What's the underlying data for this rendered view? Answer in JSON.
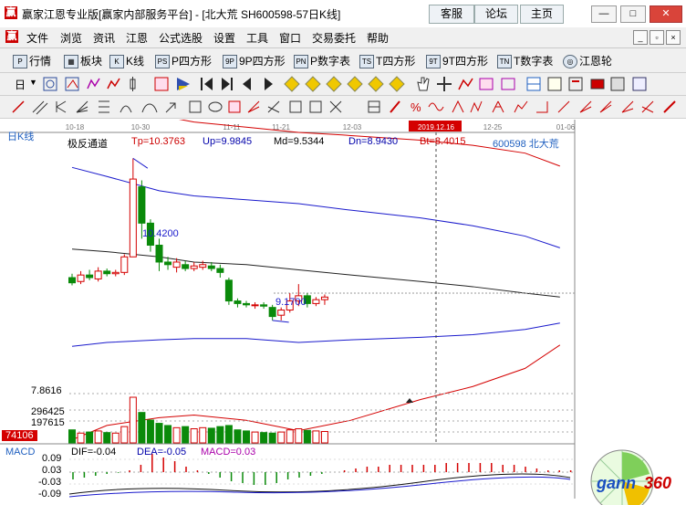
{
  "app": {
    "icon_glyph": "赢",
    "title": "赢家江恩专业版[赢家内部服务平台] - [北大荒  SH600598-57日K线]",
    "links": [
      "客服",
      "论坛",
      "主页"
    ],
    "window_buttons": [
      "—",
      "□",
      "✕"
    ]
  },
  "menu": {
    "icon_glyph": "赢",
    "items": [
      "文件",
      "浏览",
      "资讯",
      "江恩",
      "公式选股",
      "设置",
      "工具",
      "窗口",
      "交易委托",
      "帮助"
    ],
    "mdi_buttons": [
      "_",
      "▫",
      "×"
    ]
  },
  "toolbar": {
    "items": [
      {
        "icon": "P",
        "label": "行情"
      },
      {
        "icon": "▦",
        "label": "板块"
      },
      {
        "icon": "K",
        "label": "K线"
      },
      {
        "icon": "PS",
        "label": "P四方形"
      },
      {
        "icon": "9P",
        "label": "9P四方形"
      },
      {
        "icon": "PN",
        "label": "P数字表"
      },
      {
        "icon": "TS",
        "label": "T四方形"
      },
      {
        "icon": "9T",
        "label": "9T四方形"
      },
      {
        "icon": "TN",
        "label": "T数字表"
      },
      {
        "icon": "◎",
        "label": "江恩轮"
      }
    ],
    "period": "日"
  },
  "chart": {
    "date_ticks": [
      "10-18",
      "10-30",
      "11-11",
      "11-21",
      "12-03",
      "2019.12.16",
      "12-25",
      "01-06"
    ],
    "panel_label": "日K线",
    "indicator_name": "极反通道",
    "indicator_values": {
      "Tp": "Tp=10.3763",
      "Up": "Up=9.9845",
      "Md": "Md=9.5344",
      "Dn": "Dn=8.9430",
      "Bt": "Bt=8.4015"
    },
    "stock": "600598  北大荒",
    "high_label": "10.4200",
    "low_label": "9.1700",
    "volume_axis": [
      "7.8616",
      "296425",
      "197615"
    ],
    "volume_current": "74106",
    "macd": {
      "name": "MACD",
      "dif": "DIF=-0.04",
      "dea": "DEA=-0.05",
      "macd": "MACD=0.03",
      "ticks": [
        "0.09",
        "0.03",
        "-0.03",
        "-0.09"
      ]
    },
    "colors": {
      "up": "#d40000",
      "down": "#0a8a0a",
      "upper": "#d40000",
      "middle": "#1a1acc",
      "mid": "#222222"
    }
  },
  "chart_data": {
    "type": "candlestick",
    "title": "SH600598 北大荒 日K线",
    "candles": [
      {
        "o": 9.5,
        "c": 9.46,
        "h": 9.53,
        "l": 9.44
      },
      {
        "o": 9.47,
        "c": 9.52,
        "h": 9.55,
        "l": 9.45
      },
      {
        "o": 9.52,
        "c": 9.5,
        "h": 9.56,
        "l": 9.48
      },
      {
        "o": 9.49,
        "c": 9.55,
        "h": 9.58,
        "l": 9.47
      },
      {
        "o": 9.55,
        "c": 9.53,
        "h": 9.57,
        "l": 9.51
      },
      {
        "o": 9.53,
        "c": 9.54,
        "h": 9.56,
        "l": 9.51
      },
      {
        "o": 9.54,
        "c": 9.66,
        "h": 9.68,
        "l": 9.52
      },
      {
        "o": 9.66,
        "c": 10.26,
        "h": 10.42,
        "l": 9.7
      },
      {
        "o": 10.2,
        "c": 9.92,
        "h": 10.25,
        "l": 9.8
      },
      {
        "o": 9.92,
        "c": 9.75,
        "h": 9.95,
        "l": 9.7
      },
      {
        "o": 9.75,
        "c": 9.62,
        "h": 9.8,
        "l": 9.55
      },
      {
        "o": 9.62,
        "c": 9.6,
        "h": 9.66,
        "l": 9.56
      },
      {
        "o": 9.58,
        "c": 9.62,
        "h": 9.65,
        "l": 9.54
      },
      {
        "o": 9.6,
        "c": 9.57,
        "h": 9.63,
        "l": 9.55
      },
      {
        "o": 9.57,
        "c": 9.59,
        "h": 9.62,
        "l": 9.55
      },
      {
        "o": 9.58,
        "c": 9.6,
        "h": 9.63,
        "l": 9.56
      },
      {
        "o": 9.59,
        "c": 9.57,
        "h": 9.62,
        "l": 9.55
      },
      {
        "o": 9.57,
        "c": 9.54,
        "h": 9.6,
        "l": 9.5
      },
      {
        "o": 9.48,
        "c": 9.32,
        "h": 9.5,
        "l": 9.29
      },
      {
        "o": 9.32,
        "c": 9.3,
        "h": 9.34,
        "l": 9.27
      },
      {
        "o": 9.3,
        "c": 9.29,
        "h": 9.32,
        "l": 9.27
      },
      {
        "o": 9.29,
        "c": 9.29,
        "h": 9.31,
        "l": 9.26
      },
      {
        "o": 9.29,
        "c": 9.28,
        "h": 9.31,
        "l": 9.26
      },
      {
        "o": 9.27,
        "c": 9.2,
        "h": 9.29,
        "l": 9.17
      },
      {
        "o": 9.21,
        "c": 9.25,
        "h": 9.27,
        "l": 9.17
      },
      {
        "o": 9.25,
        "c": 9.32,
        "h": 9.38,
        "l": 9.23
      },
      {
        "o": 9.32,
        "c": 9.36,
        "h": 9.45,
        "l": 9.28
      },
      {
        "o": 9.36,
        "c": 9.3,
        "h": 9.38,
        "l": 9.27
      },
      {
        "o": 9.3,
        "c": 9.33,
        "h": 9.35,
        "l": 9.28
      },
      {
        "o": 9.33,
        "c": 9.35,
        "h": 9.37,
        "l": 9.29
      }
    ],
    "volume": [
      120,
      90,
      100,
      110,
      95,
      90,
      150,
      420,
      280,
      210,
      180,
      160,
      140,
      150,
      130,
      140,
      135,
      150,
      160,
      120,
      110,
      100,
      95,
      90,
      100,
      120,
      130,
      115,
      110,
      105
    ],
    "channel": {
      "upper": [
        [
          0,
          11.0
        ],
        [
          4,
          10.9
        ],
        [
          10,
          10.75
        ],
        [
          14,
          10.7
        ],
        [
          20,
          10.66
        ],
        [
          26,
          10.62
        ],
        [
          31,
          10.6
        ],
        [
          40,
          10.56
        ],
        [
          46,
          10.52
        ],
        [
          52,
          10.46
        ],
        [
          56,
          10.36
        ]
      ],
      "up2": [
        [
          0,
          10.35
        ],
        [
          4,
          10.28
        ],
        [
          10,
          10.17
        ],
        [
          14,
          10.13
        ],
        [
          20,
          10.1
        ],
        [
          26,
          10.07
        ],
        [
          32,
          10.02
        ],
        [
          40,
          9.96
        ],
        [
          46,
          9.9
        ],
        [
          52,
          9.82
        ],
        [
          56,
          9.73
        ]
      ],
      "mid": [
        [
          0,
          9.72
        ],
        [
          4,
          9.7
        ],
        [
          10,
          9.66
        ],
        [
          14,
          9.62
        ],
        [
          20,
          9.6
        ],
        [
          26,
          9.56
        ],
        [
          32,
          9.52
        ],
        [
          40,
          9.47
        ],
        [
          46,
          9.43
        ],
        [
          52,
          9.38
        ],
        [
          56,
          9.35
        ]
      ],
      "dn": [
        [
          0,
          8.97
        ],
        [
          4,
          9.0
        ],
        [
          10,
          9.02
        ],
        [
          14,
          9.03
        ],
        [
          20,
          9.03
        ],
        [
          26,
          9.0
        ],
        [
          32,
          9.02
        ],
        [
          40,
          9.04
        ],
        [
          46,
          9.06
        ],
        [
          52,
          9.1
        ],
        [
          56,
          9.15
        ]
      ],
      "bottom": [
        [
          0,
          8.25
        ],
        [
          4,
          8.36
        ],
        [
          10,
          8.42
        ],
        [
          14,
          8.44
        ],
        [
          20,
          8.4
        ],
        [
          26,
          8.32
        ],
        [
          32,
          8.4
        ],
        [
          40,
          8.56
        ],
        [
          46,
          8.66
        ],
        [
          52,
          8.8
        ],
        [
          56,
          8.98
        ]
      ]
    },
    "macd_hist": [
      -0.02,
      -0.015,
      -0.01,
      -0.005,
      -0.002,
      0.005,
      0.02,
      0.05,
      0.04,
      0.03,
      0.015,
      0.005,
      -0.005,
      -0.015,
      -0.025,
      -0.03,
      -0.035,
      -0.035,
      -0.03,
      -0.02,
      -0.015,
      -0.01,
      -0.005,
      0.0,
      0.005,
      0.01,
      0.015,
      0.015,
      0.02,
      0.02,
      0.02,
      0.02,
      0.02,
      0.025,
      0.025,
      0.025,
      0.025,
      0.025,
      0.02,
      0.02,
      0.015,
      0.01,
      0.005,
      0.005,
      0.005
    ]
  }
}
